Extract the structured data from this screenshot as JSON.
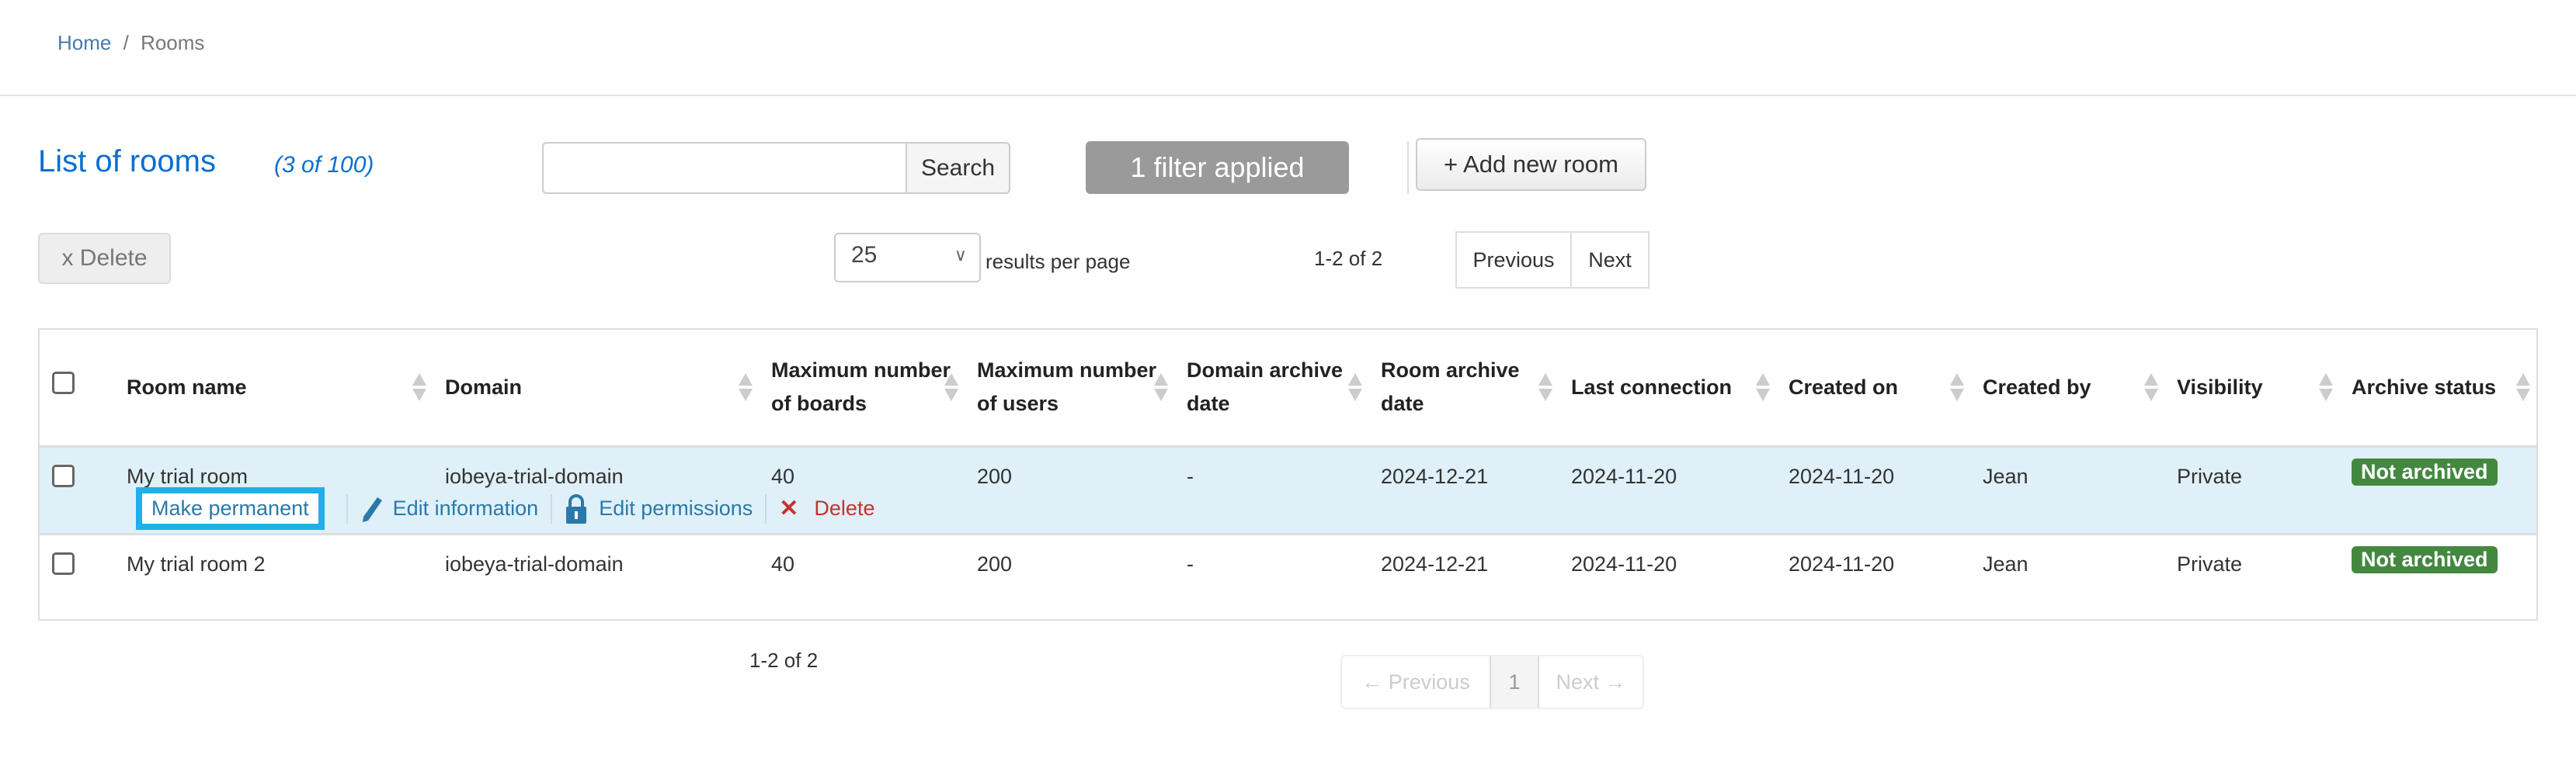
{
  "breadcrumb": {
    "home": "Home",
    "separator": "/",
    "current": "Rooms"
  },
  "header": {
    "title": "List of rooms",
    "count": "(3 of 100)",
    "search_placeholder": "",
    "search_button": "Search",
    "filter_button": "1 filter applied",
    "add_button": "+ Add new room"
  },
  "toolbar": {
    "delete_button": "x Delete",
    "per_page": "25",
    "per_page_label": "results per page",
    "range": "1-2 of 2",
    "previous": "Previous",
    "next": "Next"
  },
  "table": {
    "columns": [
      "Room name",
      "Domain",
      "Maximum number of boards",
      "Maximum number of users",
      "Domain archive date",
      "Room archive date",
      "Last connection",
      "Created on",
      "Created by",
      "Visibility",
      "Archive status"
    ],
    "rows": [
      {
        "name": "My trial room",
        "domain": "iobeya-trial-domain",
        "boards": "40",
        "users": "200",
        "domain_archive": "-",
        "room_archive": "2024-12-21",
        "last_connection": "2024-11-20",
        "created_on": "2024-11-20",
        "created_by": "Jean",
        "visibility": "Private",
        "status": "Not archived"
      },
      {
        "name": "My trial room 2",
        "domain": "iobeya-trial-domain",
        "boards": "40",
        "users": "200",
        "domain_archive": "-",
        "room_archive": "2024-12-21",
        "last_connection": "2024-11-20",
        "created_on": "2024-11-20",
        "created_by": "Jean",
        "visibility": "Private",
        "status": "Not archived"
      }
    ],
    "row_actions": {
      "make_permanent": "Make permanent",
      "edit_information": "Edit information",
      "edit_permissions": "Edit permissions",
      "delete": "Delete"
    }
  },
  "footer": {
    "range": "1-2 of 2",
    "previous": "← Previous",
    "page": "1",
    "next": "Next →"
  },
  "colors": {
    "accent": "#0b6fd1",
    "highlight": "#1eb0e8",
    "badge": "#43883f",
    "delete": "#c9302c",
    "selected_row": "#dff0f8"
  }
}
